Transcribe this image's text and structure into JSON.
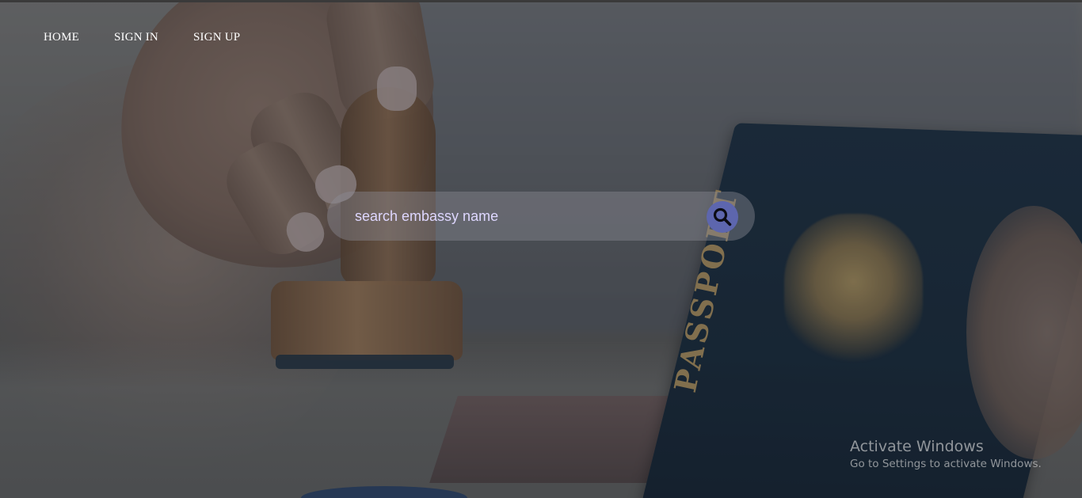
{
  "nav": {
    "items": [
      {
        "label": "HOME"
      },
      {
        "label": "SIGN IN"
      },
      {
        "label": "SIGN UP"
      }
    ]
  },
  "search": {
    "placeholder": "search embassy name",
    "value": "",
    "button_icon": "search-icon"
  },
  "background": {
    "passport_text": "PASSPORT"
  },
  "watermark": {
    "title": "Activate Windows",
    "subtitle": "Go to Settings to activate Windows."
  },
  "colors": {
    "search_button": "#5d66ae",
    "placeholder_text": "#ded7ff",
    "nav_text": "#ffffff"
  }
}
